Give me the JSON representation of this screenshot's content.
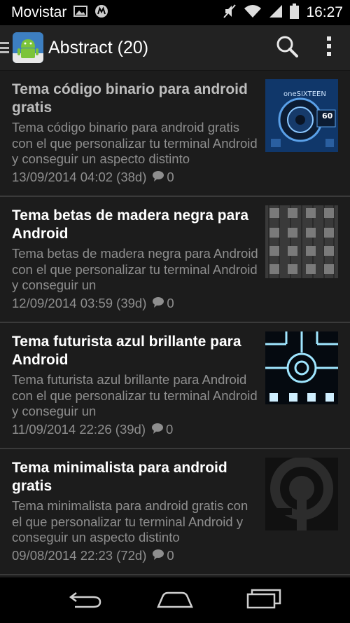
{
  "status_bar": {
    "carrier": "Movistar",
    "time": "16:27"
  },
  "action_bar": {
    "title": "Abstract (20)",
    "icons": [
      "drawer-icon",
      "app-android-icon",
      "search-icon",
      "overflow-menu-icon"
    ]
  },
  "articles": [
    {
      "title": "Tema código binario para android gratis",
      "description": "Tema código binario para android gratis con el que personalizar tu terminal Android y conseguir un aspecto distinto",
      "date": "13/09/2014 04:02 (38d)",
      "comments": "0",
      "thumb_text": "oneSIXTEEN",
      "thumb_badge": "60"
    },
    {
      "title": "Tema betas de madera negra para Android",
      "description": "Tema betas de madera negra para Android con el que personalizar tu terminal Android y conseguir un",
      "date": "12/09/2014 03:59 (39d)",
      "comments": "0"
    },
    {
      "title": "Tema futurista azul brillante para Android",
      "description": "Tema futurista azul brillante para Android con el que personalizar tu terminal Android y conseguir un",
      "date": "11/09/2014 22:26 (39d)",
      "comments": "0"
    },
    {
      "title": "Tema minimalista para android gratis",
      "description": "Tema minimalista para android gratis con el que personalizar tu terminal Android y conseguir un aspecto distinto",
      "date": "09/08/2014 22:23 (72d)",
      "comments": "0"
    }
  ],
  "nav_bar": {
    "icons": [
      "back-icon",
      "home-icon",
      "recents-icon"
    ]
  }
}
